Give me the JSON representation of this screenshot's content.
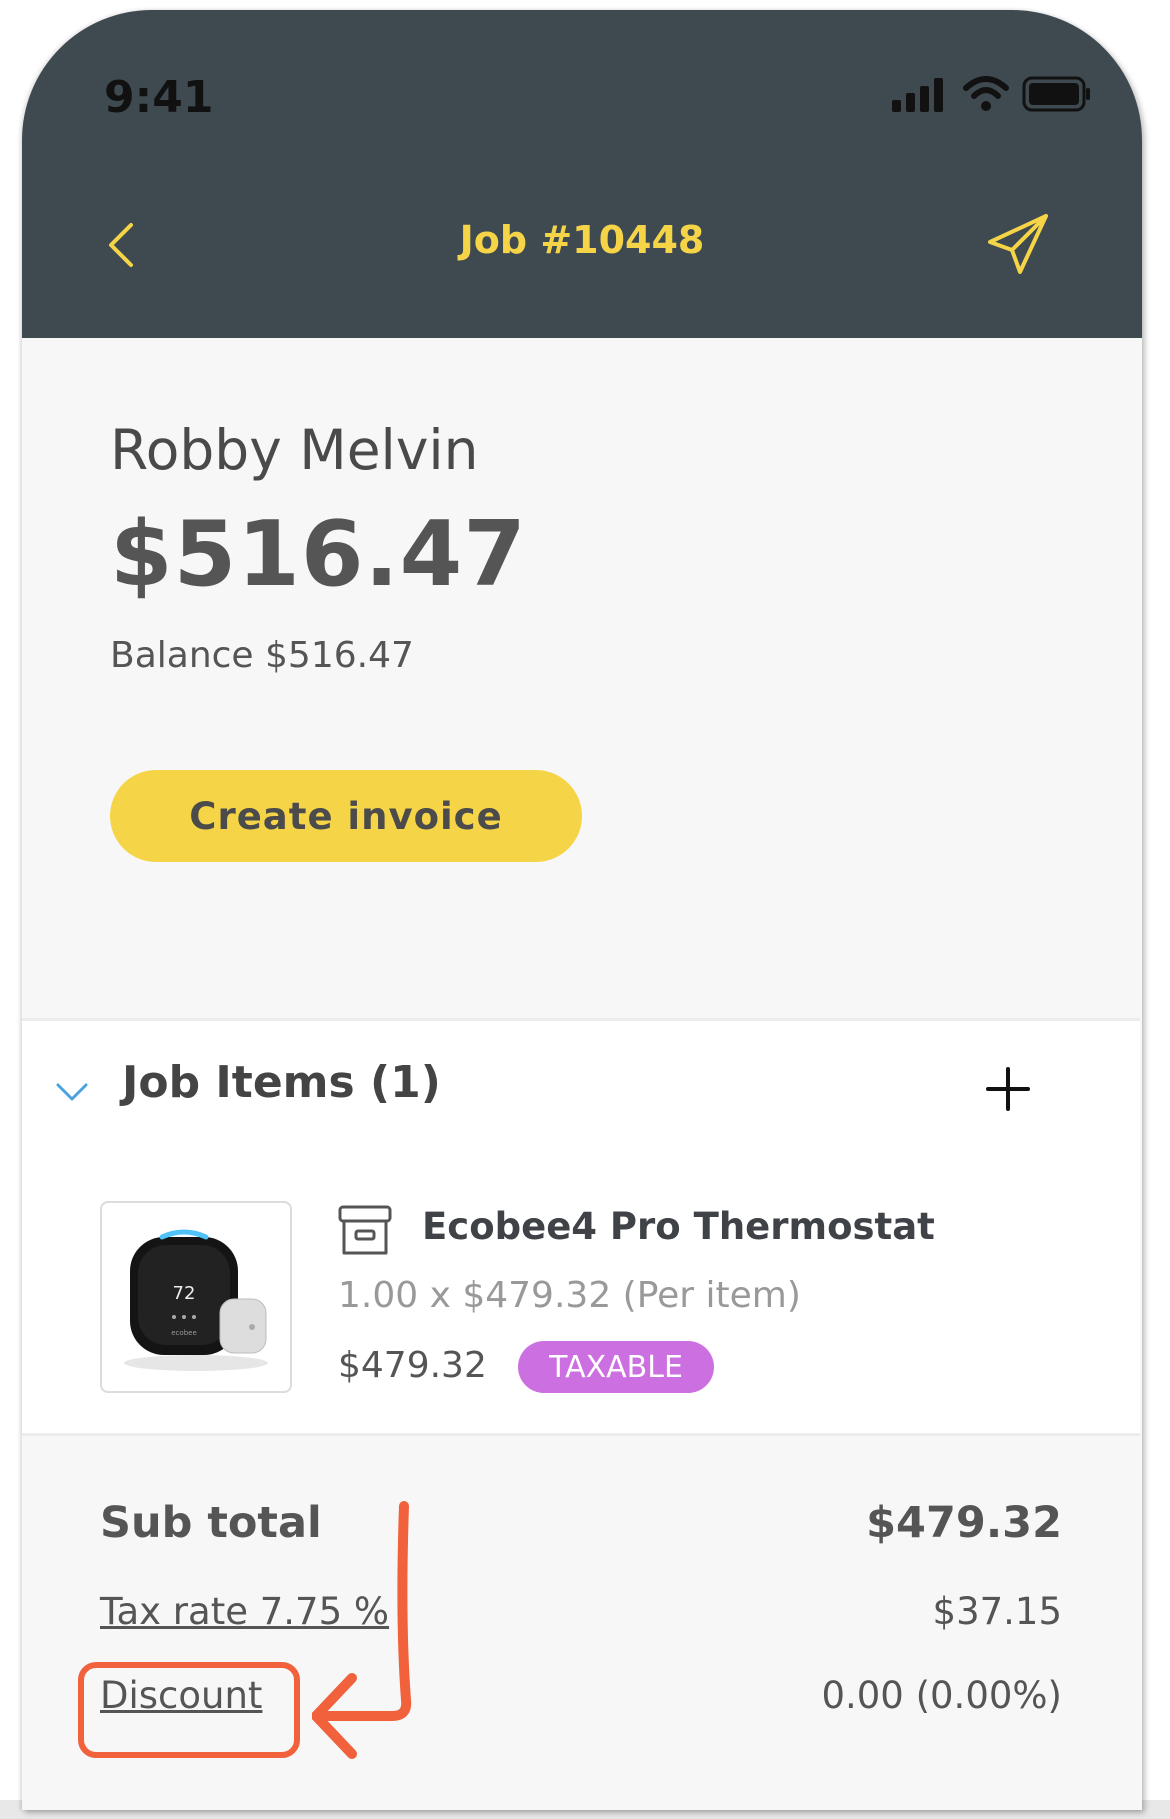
{
  "status_bar": {
    "time": "9:41",
    "signal_icon": "signal-bars-icon",
    "wifi_icon": "wifi-icon",
    "battery_icon": "battery-icon"
  },
  "header": {
    "title": "Job #10448",
    "back_icon": "chevron-left-icon",
    "send_icon": "send-icon",
    "background": "#3e4950",
    "accent": "#f5d547"
  },
  "summary": {
    "customer_name": "Robby Melvin",
    "total": "$516.47",
    "balance": "Balance $516.47",
    "create_invoice_label": "Create invoice"
  },
  "job_items": {
    "title": "Job Items (1)",
    "items": [
      {
        "name": "Ecobee4 Pro Thermostat",
        "quantity_line": "1.00 x $479.32 (Per item)",
        "price": "$479.32",
        "badge": "TAXABLE",
        "badge_color": "#cc6fe0",
        "image_display": "72",
        "image_brand": "ecobee"
      }
    ]
  },
  "totals": {
    "subtotal_label": "Sub total",
    "subtotal_value": "$479.32",
    "tax_label": "Tax rate 7.75 %",
    "tax_value": "$37.15",
    "discount_label": "Discount",
    "discount_value": "0.00 (0.00%)"
  },
  "annotation": {
    "color": "#f0613c"
  }
}
